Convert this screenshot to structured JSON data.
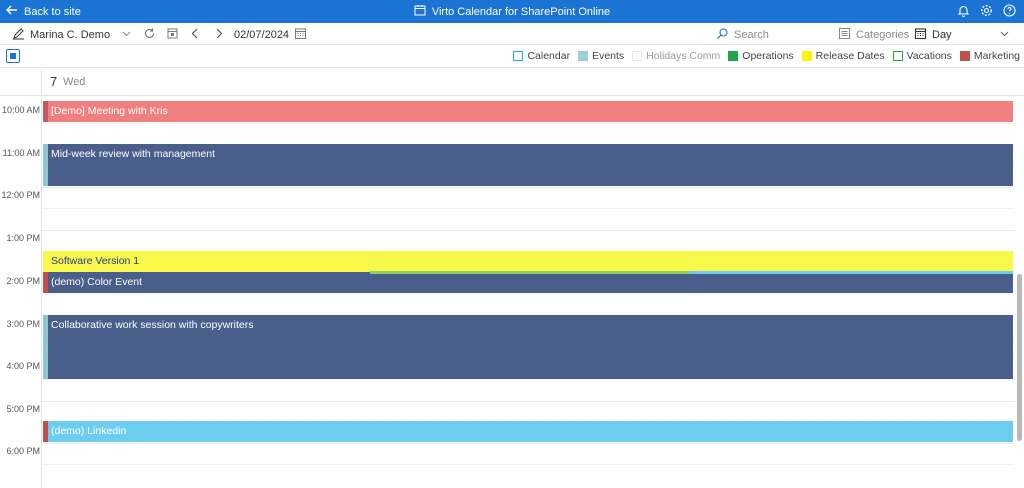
{
  "topbar": {
    "back_label": "Back to site",
    "app_title": "Virto Calendar for SharePoint Online"
  },
  "toolbar": {
    "user_name": "Marina C. Demo",
    "date_value": "02/07/2024",
    "search_placeholder": "Search",
    "categories_label": "Categories",
    "view_label": "Day"
  },
  "legend": [
    {
      "label": "Calendar",
      "color": "#19b6c9",
      "style": "outline"
    },
    {
      "label": "Events",
      "color": "#9ecfd6",
      "style": "fill"
    },
    {
      "label": "Holidays Comm",
      "color": "#e6e6e6",
      "style": "outline-light"
    },
    {
      "label": "Operations",
      "color": "#1fa64a",
      "style": "fill"
    },
    {
      "label": "Release Dates",
      "color": "#f5f50f",
      "style": "fill"
    },
    {
      "label": "Vacations",
      "color": "#22a84a",
      "style": "outline"
    },
    {
      "label": "Marketing",
      "color": "#c0504d",
      "style": "fill"
    }
  ],
  "day": {
    "number": "7",
    "name": "Wed"
  },
  "hours": [
    "10:00 AM",
    "11:00 AM",
    "12:00 PM",
    "1:00 PM",
    "2:00 PM",
    "3:00 PM",
    "4:00 PM",
    "5:00 PM",
    "6:00 PM"
  ],
  "events": [
    {
      "title": "[Demo] Meeting with Kris",
      "bg": "#f08080",
      "fg": "#ffffff",
      "stripe": "#c85a5a"
    },
    {
      "title": "Mid-week review with management",
      "bg": "#4a5e8c",
      "fg": "#ffffff",
      "stripe": "#8fc6d3"
    },
    {
      "title": "Software Version 1",
      "bg": "#f8f84a",
      "fg": "#2b3a8c",
      "stripe": "#f8f84a"
    },
    {
      "title": "(demo) Color Event",
      "bg": "#4a5e8c",
      "fg": "#ffffff",
      "stripe": "#c0504d"
    },
    {
      "title": "Collaborative work session with copywriters",
      "bg": "#4a5e8c",
      "fg": "#ffffff",
      "stripe": "#8fc6d3"
    },
    {
      "title": "(demo) Linkedin",
      "bg": "#6ccdf0",
      "fg": "#ffffff",
      "stripe": "#c0504d"
    }
  ]
}
